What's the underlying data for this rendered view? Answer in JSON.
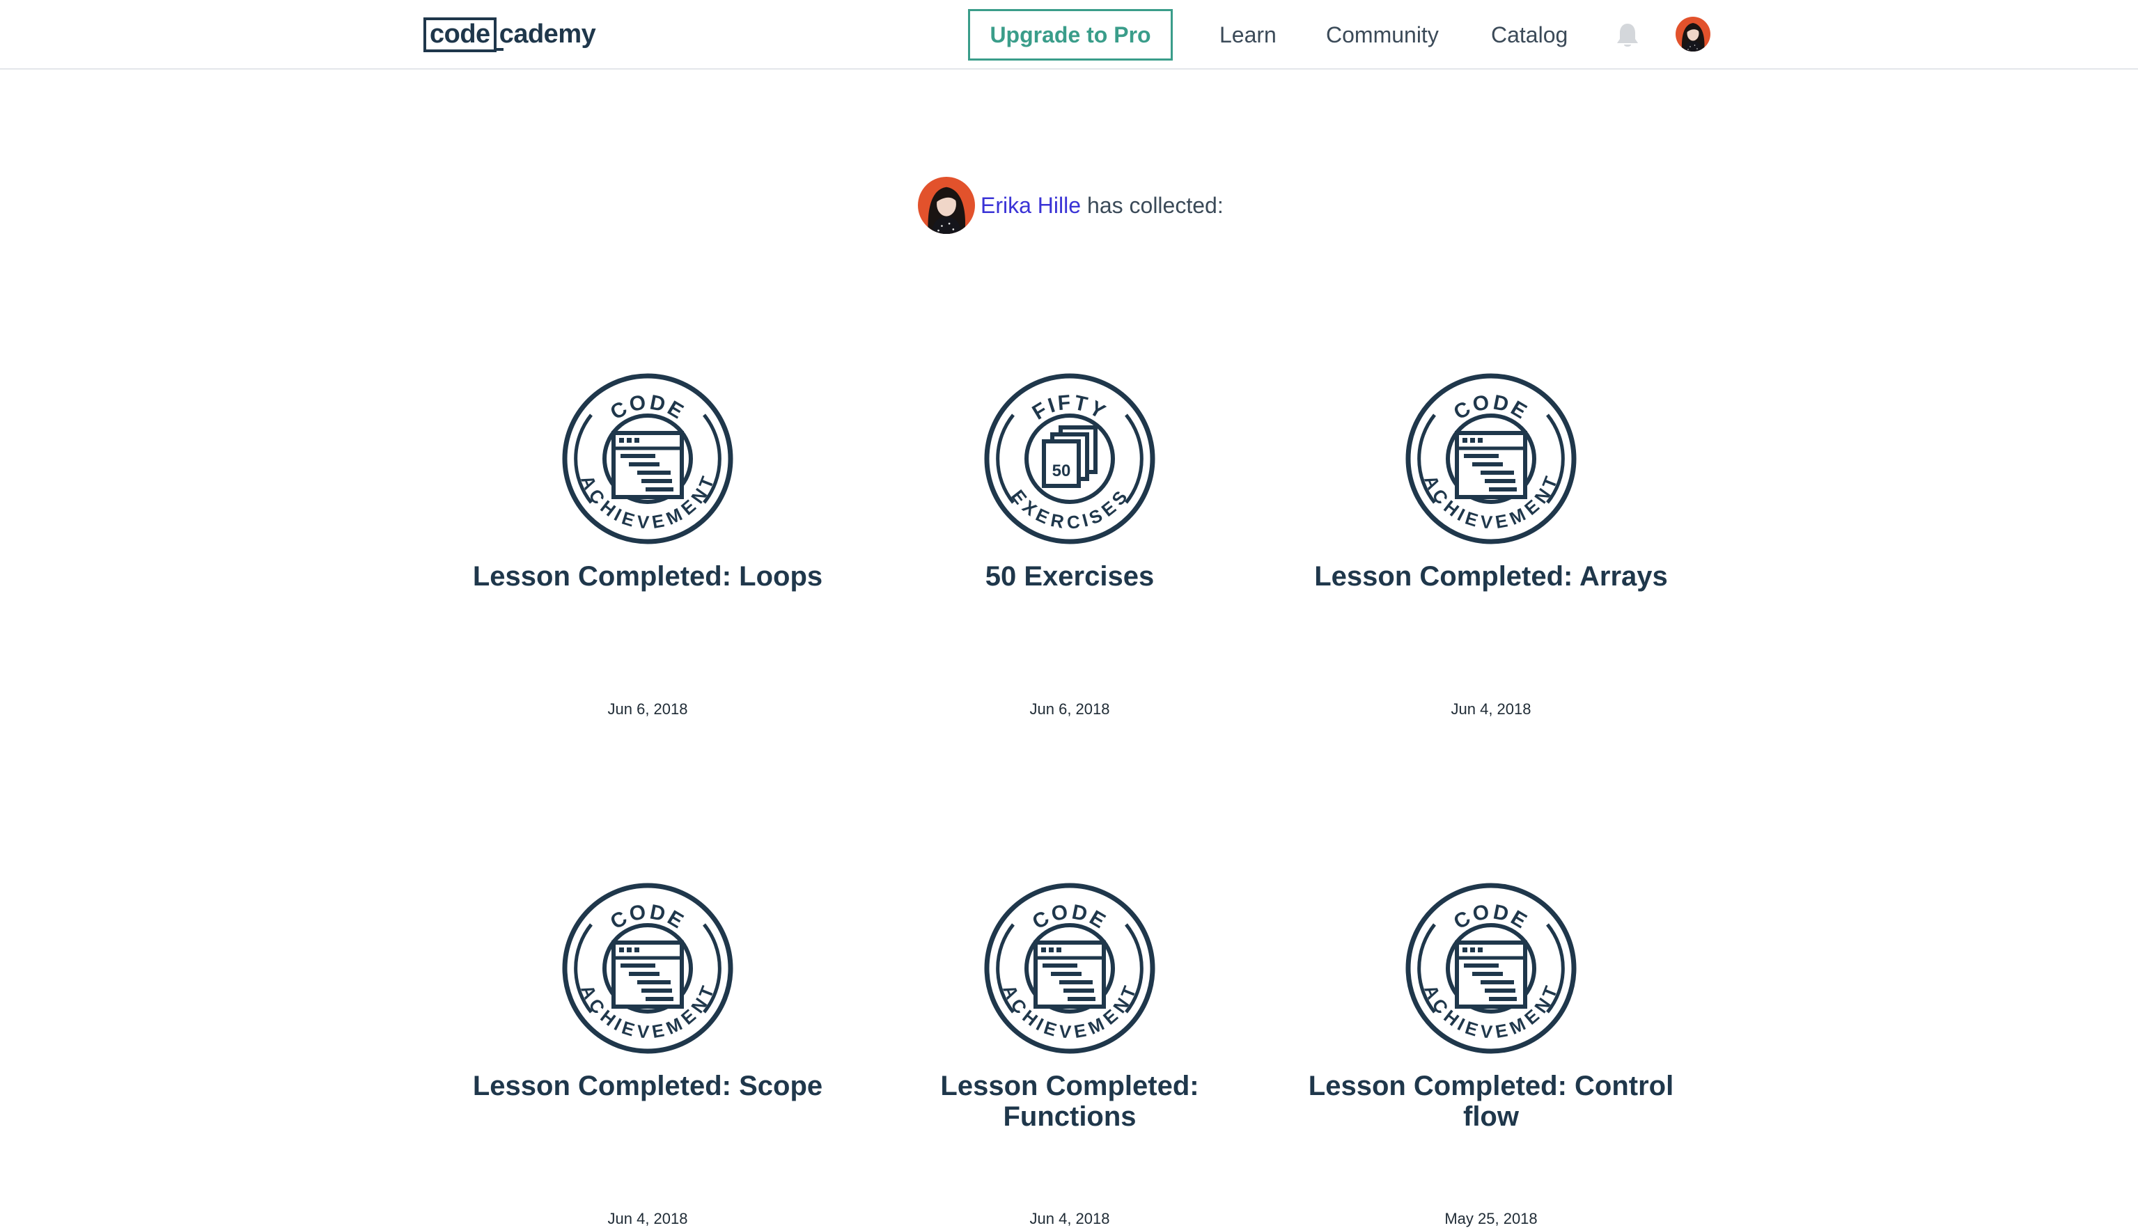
{
  "header": {
    "logo_part1": "code",
    "logo_part2": "cademy",
    "upgrade_label": "Upgrade to Pro",
    "nav": [
      "Learn",
      "Community",
      "Catalog"
    ],
    "icons": [
      "bell-icon",
      "user-avatar"
    ]
  },
  "profile": {
    "user_name": "Erika Hille",
    "collected_text": "has collected:"
  },
  "badge_text": {
    "code_top": "CODE",
    "code_bottom": "ACHIEVEMENT",
    "fifty_top": "FIFTY",
    "fifty_bottom": "EXERCISES",
    "fifty_number": "50"
  },
  "achievements": [
    {
      "title": "Lesson Completed: Loops",
      "date": "Jun 6, 2018",
      "badge": "code-achievement"
    },
    {
      "title": "50 Exercises",
      "date": "Jun 6, 2018",
      "badge": "fifty-exercises"
    },
    {
      "title": "Lesson Completed: Arrays",
      "date": "Jun 4, 2018",
      "badge": "code-achievement"
    },
    {
      "title": "Lesson Completed: Scope",
      "date": "Jun 4, 2018",
      "badge": "code-achievement"
    },
    {
      "title": "Lesson Completed: Functions",
      "date": "Jun 4, 2018",
      "badge": "code-achievement"
    },
    {
      "title": "Lesson Completed: Control flow",
      "date": "May 25, 2018",
      "badge": "code-achievement"
    }
  ],
  "colors": {
    "badge": "#1f374b",
    "accent": "#3a9d8a",
    "link": "#3a33d6",
    "avatar_bg": "#e2522c"
  }
}
